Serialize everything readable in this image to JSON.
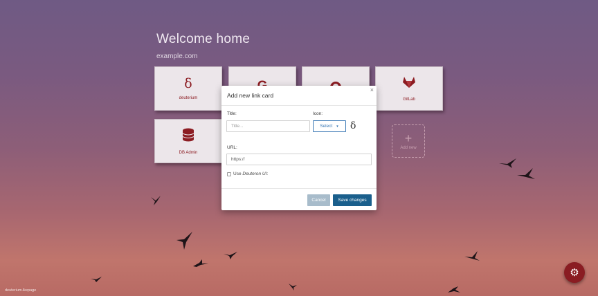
{
  "header": {
    "title": "Welcome home",
    "subtitle": "example.com"
  },
  "cards": [
    {
      "label": "deuterium",
      "glyph": "δ",
      "icon": "delta-icon"
    },
    {
      "label": "",
      "glyph": "G",
      "icon": "google-icon"
    },
    {
      "label": "",
      "glyph": "",
      "icon": "github-icon"
    },
    {
      "label": "GitLab",
      "glyph": "",
      "icon": "gitlab-icon"
    },
    {
      "label": "DB Admin",
      "glyph": "",
      "icon": "database-icon"
    }
  ],
  "add_card": {
    "label": "Add new"
  },
  "modal": {
    "title": "Add new link card",
    "close": "×",
    "title_label": "Title:",
    "title_placeholder": "Title...",
    "icon_label": "Icon:",
    "select_label": "Select",
    "icon_preview": "δ",
    "url_label": "URL:",
    "url_value": "https://",
    "use_text_prefix": "Use ",
    "use_text_italic": "Deuteron UI",
    "use_text_suffix": ":",
    "cancel_label": "Cancel",
    "save_label": "Save changes"
  },
  "footer": {
    "text": "deuterium.lkepage"
  },
  "colors": {
    "accent": "#8c1c22",
    "primary_button": "#1a5f8c",
    "cancel_button": "#a8bccb",
    "fab": "#8a1c22"
  },
  "fab_icon": "gear-icon"
}
